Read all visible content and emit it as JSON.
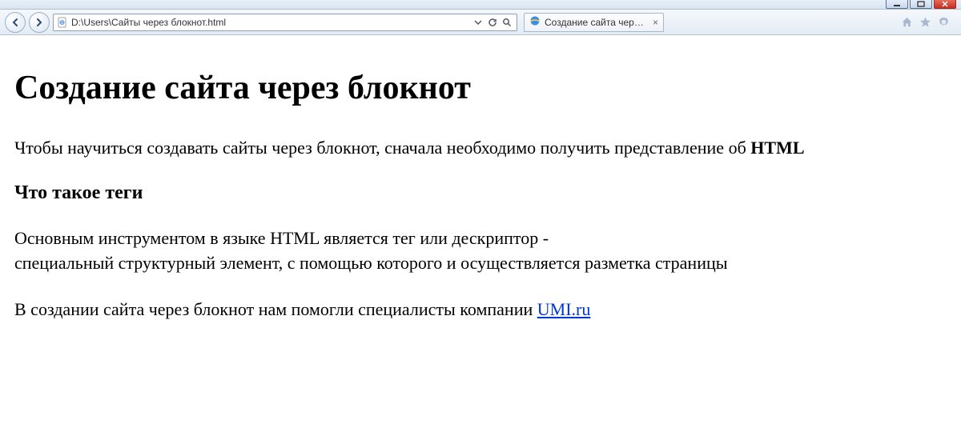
{
  "window": {
    "address": "D:\\Users\\Сайты через блокнот.html",
    "tab_title": "Создание сайта через бло..."
  },
  "page": {
    "heading": "Создание сайта через блокнот",
    "intro_before_bold": "Чтобы научиться создавать сайты через блокнот, сначала необходимо получить представление об ",
    "intro_bold": "HTML",
    "subheading": "Что такое теги",
    "para2_line1": "Основным инструментом в языке HTML является тег или дескриптор -",
    "para2_line2": "специальный структурный элемент, с помощью которого и осуществляется разметка страницы",
    "para3_prefix": "В создании сайта через блокнот нам помогли специалисты компании ",
    "para3_link_text": "UMI.ru"
  }
}
